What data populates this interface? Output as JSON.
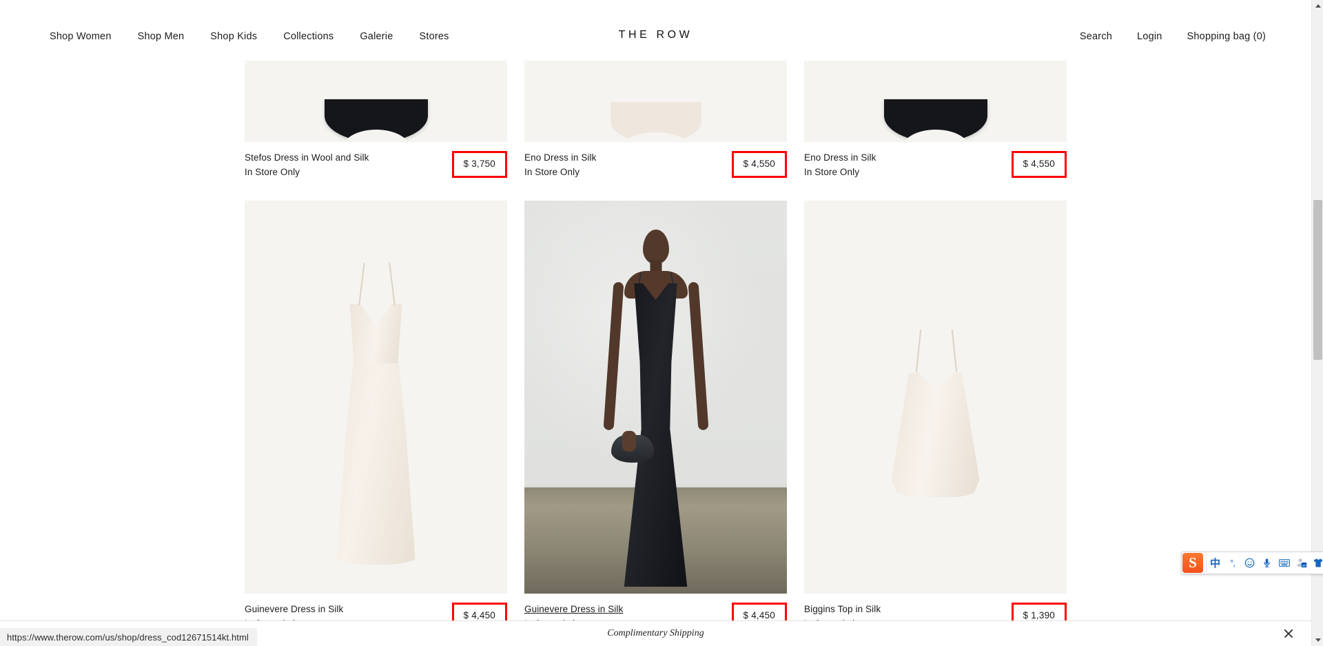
{
  "header": {
    "brand": "THE ROW",
    "nav_left": [
      {
        "label": "Shop Women"
      },
      {
        "label": "Shop Men"
      },
      {
        "label": "Shop Kids"
      },
      {
        "label": "Collections"
      },
      {
        "label": "Galerie"
      },
      {
        "label": "Stores"
      }
    ],
    "nav_right": [
      {
        "label": "Search"
      },
      {
        "label": "Login"
      },
      {
        "label": "Shopping bag (0)"
      }
    ]
  },
  "grid": {
    "row1": [
      {
        "title": "Stefos Dress in Wool and Silk",
        "availability": "In Store Only",
        "price": "$ 3,750",
        "highlighted": true,
        "hovered": false
      },
      {
        "title": "Eno Dress in Silk",
        "availability": "In Store Only",
        "price": "$ 4,550",
        "highlighted": true,
        "hovered": false
      },
      {
        "title": "Eno Dress in Silk",
        "availability": "In Store Only",
        "price": "$ 4,550",
        "highlighted": true,
        "hovered": false
      }
    ],
    "row2": [
      {
        "title": "Guinevere Dress in Silk",
        "availability": "In Store Only",
        "price": "$ 4,450",
        "highlighted": true,
        "hovered": false
      },
      {
        "title": "Guinevere Dress in Silk",
        "availability": "In Store Only",
        "price": "$ 4,450",
        "highlighted": true,
        "hovered": true
      },
      {
        "title": "Biggins Top in Silk",
        "availability": "In Store Only",
        "price": "$ 1,390",
        "highlighted": true,
        "hovered": false
      }
    ]
  },
  "footer": {
    "message": "Complimentary Shipping",
    "close_icon": "close-icon"
  },
  "status_bar": {
    "url": "https://www.therow.com/us/shop/dress_cod12671514kt.html"
  },
  "ime": {
    "logo_text": "S",
    "items": [
      {
        "icon": "chinese-mode-icon",
        "label": "中"
      },
      {
        "icon": "punctuation-mode-icon",
        "label": "°,"
      },
      {
        "icon": "emoji-icon",
        "label": ""
      },
      {
        "icon": "voice-input-icon",
        "label": ""
      },
      {
        "icon": "soft-keyboard-icon",
        "label": ""
      },
      {
        "icon": "user-calendar-icon",
        "label": ""
      },
      {
        "icon": "skin-shirt-icon",
        "label": ""
      },
      {
        "icon": "toolbox-grid-icon",
        "label": ""
      }
    ]
  },
  "scrollbar": {
    "up_arrow": "chevron-up-icon",
    "down_arrow": "chevron-down-icon"
  },
  "colors": {
    "annotation": "#ff0000",
    "product_bg": "#f5f4f1",
    "text": "#1c1c1c"
  }
}
